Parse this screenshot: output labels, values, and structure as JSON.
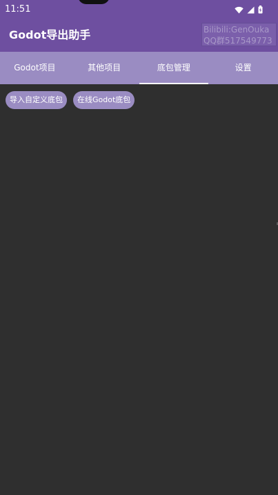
{
  "status_bar": {
    "time": "11:51",
    "icons": [
      "wifi-icon",
      "cell-signal-icon",
      "battery-icon"
    ],
    "color": "#6e4fa0"
  },
  "app_bar": {
    "title": "Godot导出助手",
    "watermark": {
      "line1": "Bilibili:GenOuka",
      "line2": "QQ群517549773"
    },
    "color": "#6e4fa0"
  },
  "tabs": {
    "items": [
      {
        "label": "Godot项目",
        "active": false
      },
      {
        "label": "其他项目",
        "active": false
      },
      {
        "label": "底包管理",
        "active": true
      },
      {
        "label": "设置",
        "active": false
      }
    ],
    "color": "#9a8cc2"
  },
  "actions": {
    "import_custom_label": "导入自定义底包",
    "online_godot_label": "在线Godot底包",
    "chip_color": "#9a8cc2"
  },
  "content": {
    "background": "#2f2f2f"
  }
}
